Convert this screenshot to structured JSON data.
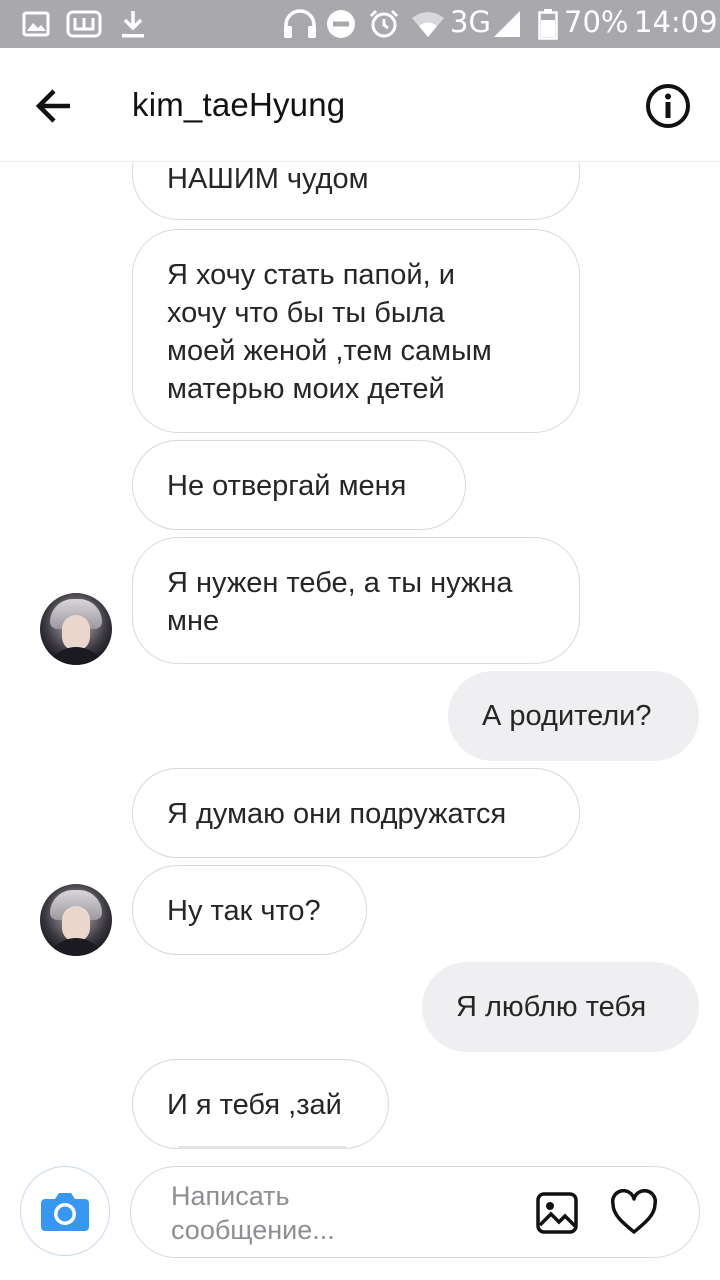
{
  "status_bar": {
    "network": "3G",
    "battery": "70%",
    "time": "14:09"
  },
  "header": {
    "title": "kim_taeHyung"
  },
  "messages": [
    {
      "direction": "incoming",
      "text": "НАШИМ чудом"
    },
    {
      "direction": "incoming",
      "text": "Я хочу стать папой, и\nхочу что бы ты была\nмоей женой ,тем самым\nматерью моих детей"
    },
    {
      "direction": "incoming",
      "text": "Не отвергай меня"
    },
    {
      "direction": "incoming",
      "text": "Я нужен тебе, а ты нужна\nмне"
    },
    {
      "direction": "outgoing",
      "text": "А родители?"
    },
    {
      "direction": "incoming",
      "text": "Я думаю они подружатся"
    },
    {
      "direction": "incoming",
      "text": "Ну так что?"
    },
    {
      "direction": "outgoing",
      "text": "Я люблю тебя"
    },
    {
      "direction": "incoming",
      "text": "И я тебя ,зай"
    }
  ],
  "composer": {
    "placeholder": "Написать\nсообщение..."
  },
  "icons": {
    "back": "arrow-left-icon",
    "info": "info-icon",
    "camera": "camera-icon",
    "gallery": "image-icon",
    "like": "heart-icon"
  },
  "colors": {
    "status_bar": "#a9a9ad",
    "camera_accent": "#3897f0",
    "incoming_border": "#d8d8dd",
    "outgoing_fill": "#efeff1"
  }
}
